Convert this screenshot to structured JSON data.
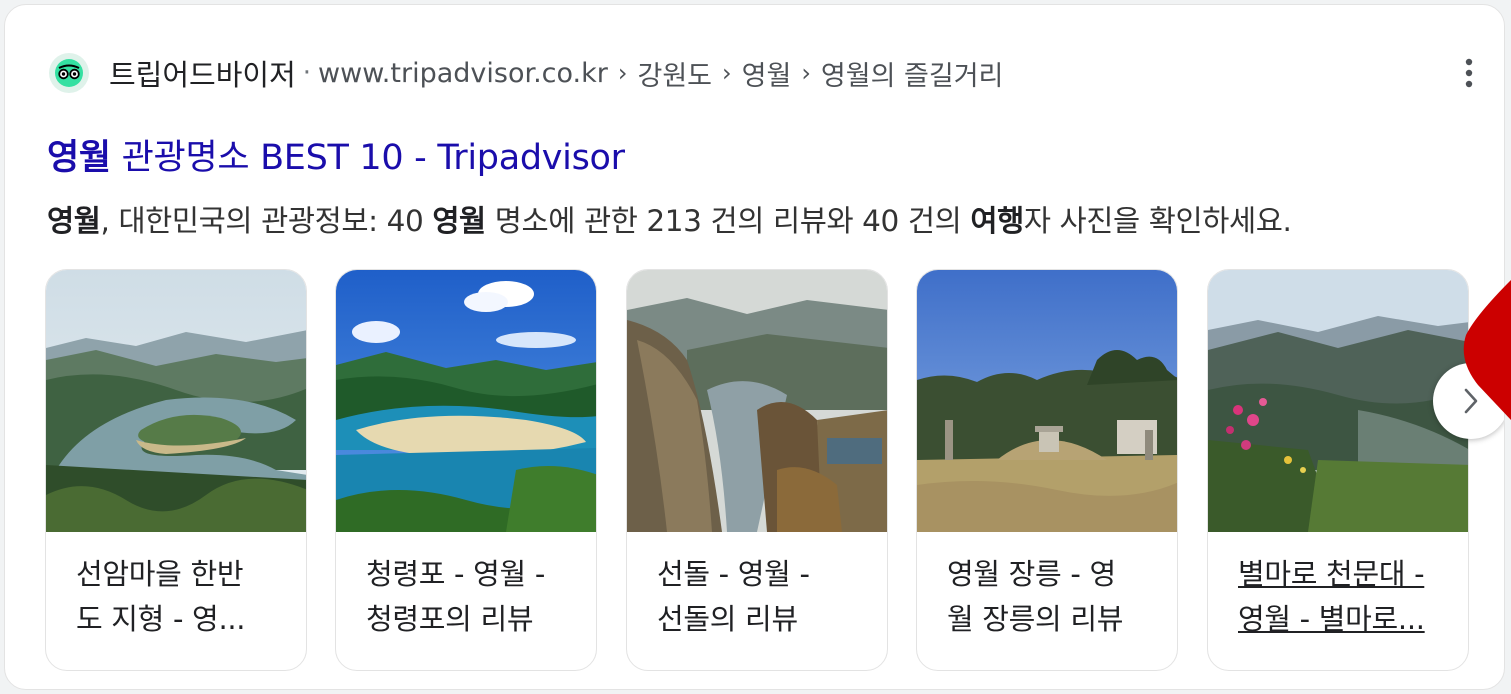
{
  "source": {
    "site_name": "트립어드바이저",
    "separator": "·",
    "url": "www.tripadvisor.co.kr",
    "breadcrumbs": [
      "강원도",
      "영월",
      "영월의 즐길거리"
    ],
    "favicon_icon": "tripadvisor-owl-icon",
    "more_icon": "more-vert-icon"
  },
  "result": {
    "title_bold": "영월",
    "title_rest": " 관광명소 BEST 10 - Tripadvisor",
    "snippet": {
      "p1_bold": "영월",
      "p2": ", 대한민국의 관광정보: 40 ",
      "p3_bold": "영월",
      "p4": " 명소에 관한 213 건의 리뷰와 40 건의 ",
      "p5_bold": "여행",
      "p6": "자 사진을 확인하세요."
    }
  },
  "cards": [
    {
      "line1": "선암마을 한반",
      "line2": "도 지형 - 영..."
    },
    {
      "line1": "청령포 - 영월 -",
      "line2": "청령포의 리뷰"
    },
    {
      "line1": "선돌 - 영월 -",
      "line2": "선돌의 리뷰"
    },
    {
      "line1": "영월 장릉 - 영",
      "line2": "월 장릉의 리뷰"
    },
    {
      "line1": "별마로 천문대 -",
      "line2": "영월 - 별마로..."
    }
  ],
  "next_icon": "chevron-right-icon",
  "colors": {
    "title_link": "#1a0dab",
    "favicon_bg": "#dff2ea",
    "accent_red": "#cc0000"
  }
}
